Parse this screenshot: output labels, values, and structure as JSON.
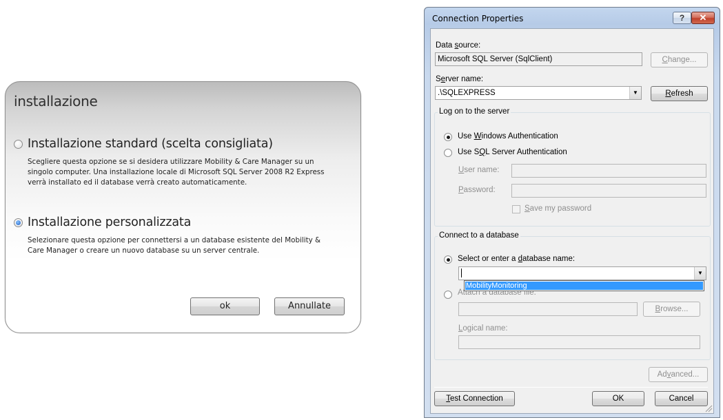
{
  "installer": {
    "title": "installazione",
    "options": [
      {
        "label": "Installazione standard (scelta consigliata)",
        "description": "Scegliere questa opzione se si desidera utilizzare Mobility & Care Manager su un\nsingolo computer. Una installazione locale di Microsoft SQL Server 2008 R2 Express\nverrà installato ed il database verrà creato automaticamente.",
        "selected": false
      },
      {
        "label": "Installazione personalizzata",
        "description": "Selezionare questa opzione per connettersi a un database esistente del Mobility &\nCare Manager o creare un nuovo database su un server centrale.",
        "selected": true
      }
    ],
    "ok_label": "ok",
    "cancel_label": "Annullate"
  },
  "connection": {
    "title": "Connection Properties",
    "help_label": "?",
    "close_label": "✕",
    "data_source": {
      "label_pre": "Data ",
      "label_key": "s",
      "label_post": "ource:",
      "value": "Microsoft SQL Server (SqlClient)",
      "change_pre": "",
      "change_key": "C",
      "change_post": "hange..."
    },
    "server": {
      "label_pre": "S",
      "label_key": "e",
      "label_post": "rver name:",
      "value": ".\\SQLEXPRESS",
      "refresh_pre": "",
      "refresh_key": "R",
      "refresh_post": "efresh"
    },
    "logon": {
      "group_label": "Log on to the server",
      "windows_pre": "Use ",
      "windows_key": "W",
      "windows_post": "indows Authentication",
      "sql_pre": "Use S",
      "sql_key": "Q",
      "sql_post": "L Server Authentication",
      "user_key": "U",
      "user_post": "ser name:",
      "password_key": "P",
      "password_post": "assword:",
      "save_key": "S",
      "save_post": "ave my password",
      "auth_selected": "windows"
    },
    "database": {
      "group_label": "Connect to a database",
      "select_pre": "Select or enter a ",
      "select_key": "d",
      "select_post": "atabase name:",
      "name_value": "",
      "dropdown_item": "MobilityMonitoring",
      "attach_label": "Attach a database file:",
      "browse_key": "B",
      "browse_post": "rowse...",
      "logical_key": "L",
      "logical_post": "ogical name:"
    },
    "advanced_pre": "Ad",
    "advanced_key": "v",
    "advanced_post": "anced...",
    "test_key": "T",
    "test_post": "est Connection",
    "ok_label": "OK",
    "cancel_label": "Cancel"
  }
}
